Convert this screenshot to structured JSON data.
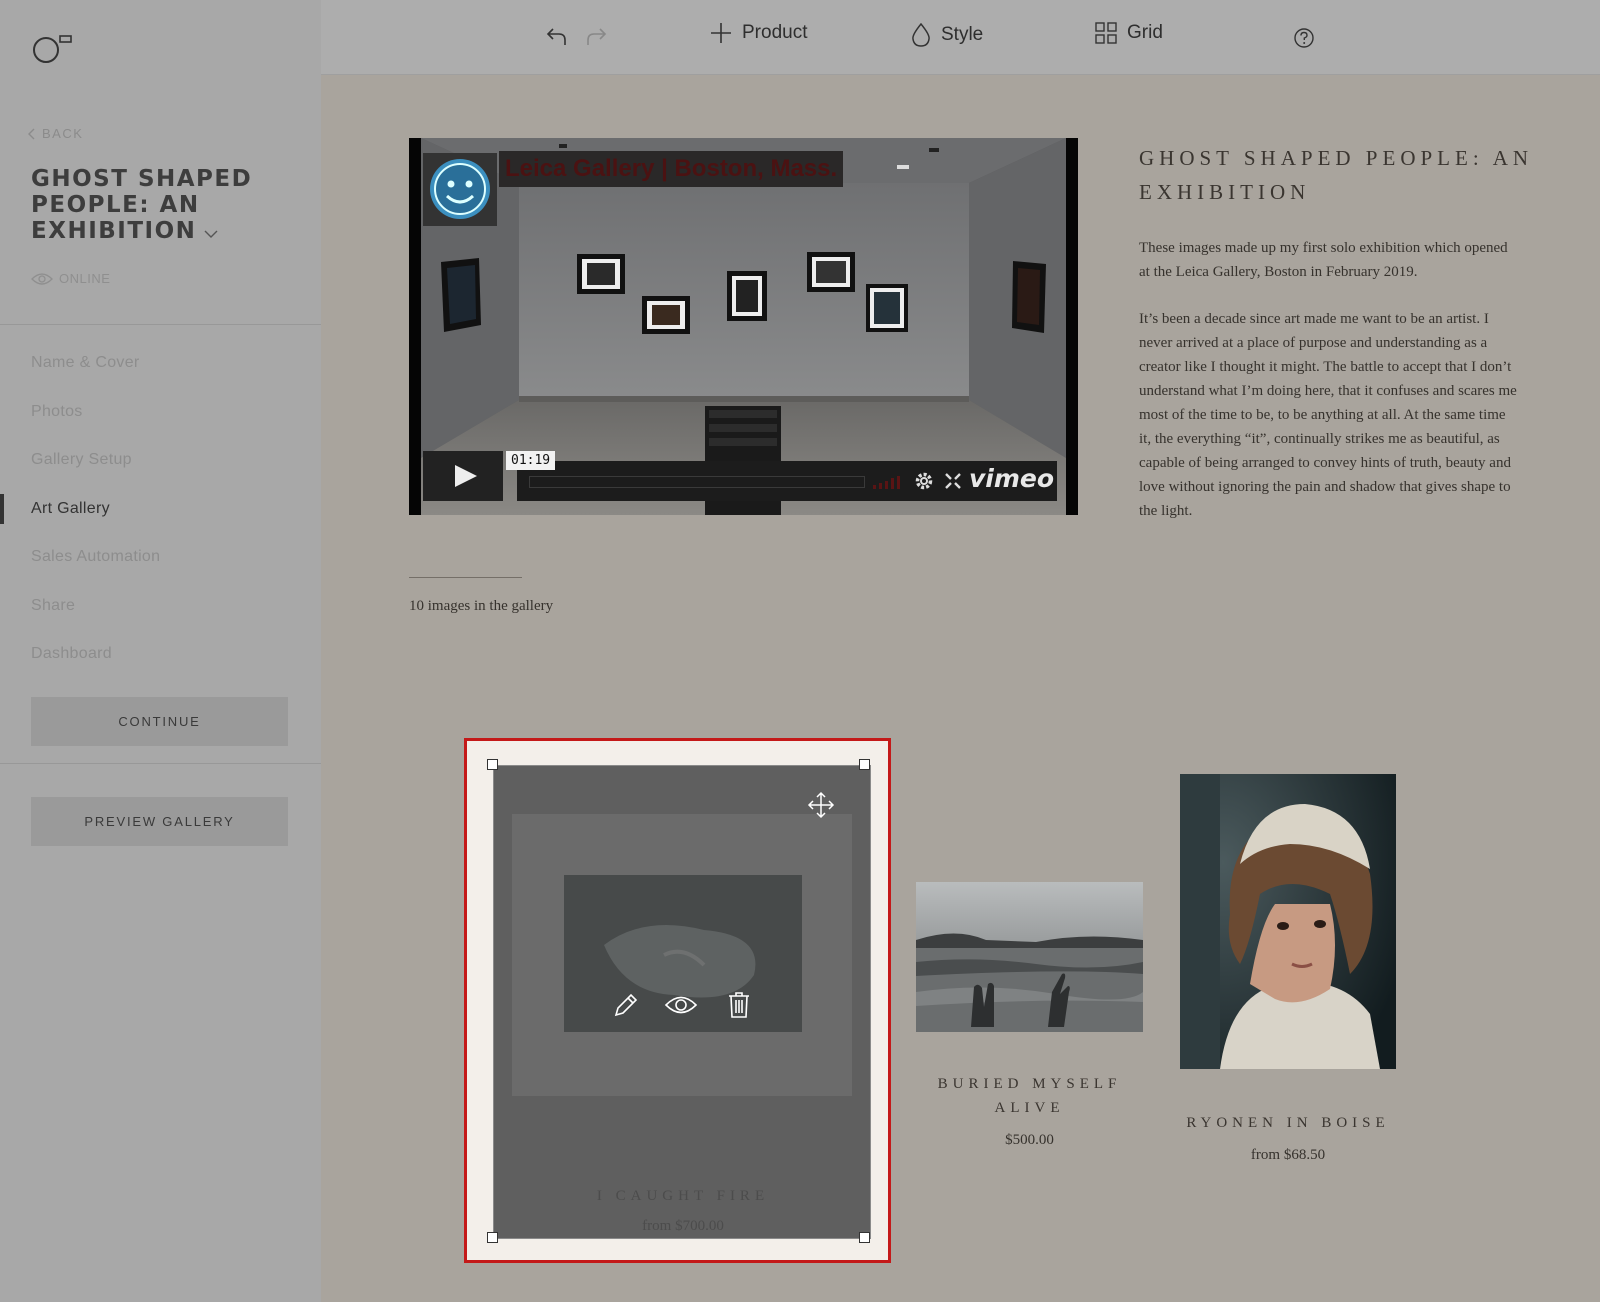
{
  "sidebar": {
    "back_label": "BACK",
    "gallery_title": "GHOST SHAPED PEOPLE: AN EXHIBITION",
    "status": "ONLINE",
    "nav": [
      {
        "label": "Name & Cover",
        "active": false
      },
      {
        "label": "Photos",
        "active": false
      },
      {
        "label": "Gallery Setup",
        "active": false
      },
      {
        "label": "Art Gallery",
        "active": true
      },
      {
        "label": "Sales Automation",
        "active": false
      },
      {
        "label": "Share",
        "active": false
      },
      {
        "label": "Dashboard",
        "active": false
      }
    ],
    "continue_label": "CONTINUE",
    "preview_label": "PREVIEW GALLERY"
  },
  "toolbar": {
    "product_label": "Product",
    "style_label": "Style",
    "grid_label": "Grid"
  },
  "video": {
    "overlay_title": "Leica Gallery | Boston, Mass.",
    "time": "01:19",
    "brand": "vimeo"
  },
  "exhibition": {
    "title": "GHOST SHAPED PEOPLE: AN EXHIBITION",
    "paragraphs": [
      "These images made up my first solo exhibition which opened at the Leica Gallery, Boston in February 2019.",
      "It’s been a decade since art made me want to be an artist. I never arrived at a place of purpose and understanding as a creator like I thought it might. The battle to accept that I don’t understand what I’m doing here, that it confuses and scares me most of the time to be, to be anything at all. At the same time it, the everything “it”, continually strikes me as beautiful, as capable of being arranged to convey hints of truth, beauty and love without ignoring the pain and shadow that gives shape to the light."
    ],
    "image_count": "10 images in the gallery"
  },
  "products": [
    {
      "title": "I CAUGHT FIRE",
      "price": "from $700.00",
      "selected": true
    },
    {
      "title": "BURIED MYSELF ALIVE",
      "price": "$500.00",
      "selected": false
    },
    {
      "title": "RYONEN IN BOISE",
      "price": "from $68.50",
      "selected": false
    }
  ],
  "colors": {
    "selection_border": "#c41919",
    "sidebar_bg": "#a8a8a8",
    "canvas_bg": "#a9a49d"
  }
}
